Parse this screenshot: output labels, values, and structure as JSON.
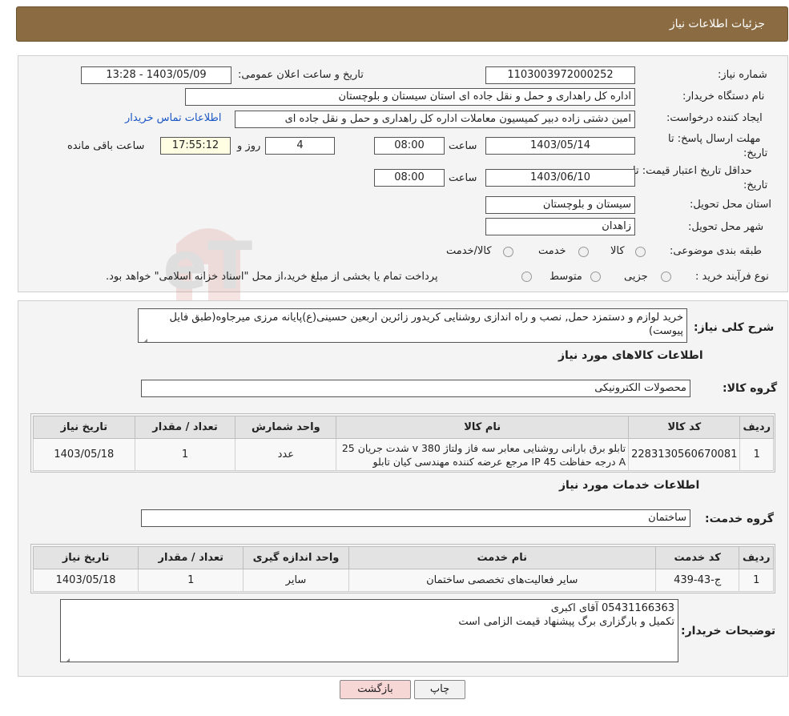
{
  "header": {
    "title": "جزئیات اطلاعات نیاز"
  },
  "form": {
    "need_number_label": "شماره نیاز:",
    "need_number": "1103003972000252",
    "announce_label": "تاریخ و ساعت اعلان عمومی:",
    "announce_value": "1403/05/09 - 13:28",
    "buyer_org_label": "نام دستگاه خریدار:",
    "buyer_org": "اداره کل راهداری و حمل و نقل جاده ای استان سیستان و بلوچستان",
    "creator_label": "ایجاد کننده درخواست:",
    "creator": "امین دشتی زاده دبیر کمیسیون معاملات اداره کل راهداری و حمل و نقل جاده ای",
    "contact_link": "اطلاعات تماس خریدار",
    "deadline_label_1": "مهلت ارسال پاسخ: تا",
    "deadline_label_2": "تاریخ:",
    "deadline_date": "1403/05/14",
    "time_label": "ساعت",
    "deadline_time": "08:00",
    "days_value": "4",
    "days_label": "روز و",
    "remaining_time": "17:55:12",
    "remaining_label": "ساعت باقی مانده",
    "validity_label_1": "حداقل تاریخ اعتبار قیمت: تا",
    "validity_label_2": "تاریخ:",
    "validity_date": "1403/06/10",
    "validity_time": "08:00",
    "province_label": "استان محل تحویل:",
    "province": "سیستان و بلوچستان",
    "city_label": "شهر محل تحویل:",
    "city": "زاهدان",
    "category_label": "طبقه بندی موضوعی:",
    "category_options": [
      "کالا",
      "خدمت",
      "کالا/خدمت"
    ],
    "process_label": "نوع فرآیند خرید :",
    "process_options": [
      "جزیی",
      "متوسط"
    ],
    "process_note": "پرداخت تمام یا بخشی از مبلغ خرید،از محل \"اسناد خزانه اسلامی\" خواهد بود."
  },
  "summary": {
    "label": "شرح کلی نیاز:",
    "text": "خرید لوازم و دستمزد حمل, نصب و راه اندازی روشنایی کریدور زائرین اربعین حسینی(ع)پایانه مرزی میرجاوه(طبق فایل پیوست)"
  },
  "goods": {
    "section_title": "اطلاعات کالاهای مورد نیاز",
    "group_label": "گروه کالا:",
    "group_value": "محصولات الکترونیکی",
    "headers": [
      "ردیف",
      "کد کالا",
      "نام کالا",
      "واحد شمارش",
      "تعداد / مقدار",
      "تاریخ نیاز"
    ],
    "rows": [
      {
        "row": "1",
        "code": "2283130560670081",
        "name": "تابلو برق بارانی روشنایی معابر سه فاز ولتاژ 380 v شدت جریان 25 A درجه حفاظت IP 45 مرجع عرضه کننده مهندسی کیان تابلو",
        "unit": "عدد",
        "qty": "1",
        "date": "1403/05/18"
      }
    ]
  },
  "services": {
    "section_title": "اطلاعات خدمات مورد نیاز",
    "group_label": "گروه خدمت:",
    "group_value": "ساختمان",
    "headers": [
      "ردیف",
      "کد خدمت",
      "نام خدمت",
      "واحد اندازه گیری",
      "تعداد / مقدار",
      "تاریخ نیاز"
    ],
    "rows": [
      {
        "row": "1",
        "code": "ج-43-439",
        "name": "سایر فعالیت‌های تخصصی ساختمان",
        "unit": "سایر",
        "qty": "1",
        "date": "1403/05/18"
      }
    ]
  },
  "buyer_notes": {
    "label": "توضیحات خریدار:",
    "line1": "05431166363 آقای اکبری",
    "line2": "تکمیل و بارگزاری برگ پیشنهاد قیمت الزامی است"
  },
  "buttons": {
    "print": "چاپ",
    "back": "بازگشت"
  },
  "watermark": {
    "text": "AriaTender.neT"
  },
  "colors": {
    "header": "#8b6b42",
    "link": "#1a56c4",
    "back_button": "#f7d6d6"
  }
}
